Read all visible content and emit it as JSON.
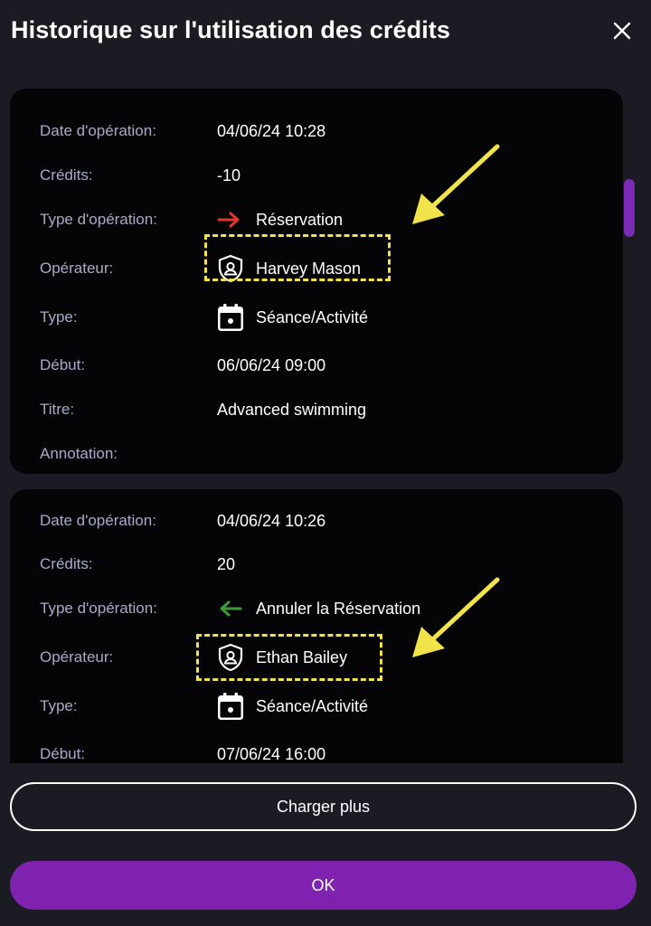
{
  "dialog": {
    "title": "Historique sur l'utilisation des crédits",
    "close_icon": "close-icon"
  },
  "entries": [
    {
      "rows": [
        {
          "label": "Date d'opération:",
          "value": "04/06/24 10:28"
        },
        {
          "label": "Crédits:",
          "value": "-10"
        },
        {
          "label": "Type d'opération:",
          "value": "Réservation",
          "icon": "arrow-right-icon",
          "icon_color": "#e8372c"
        },
        {
          "label": "Opérateur:",
          "value": "Harvey Mason",
          "icon": "shield-user-icon"
        },
        {
          "label": "Type:",
          "value": "Séance/Activité",
          "icon": "calendar-icon"
        },
        {
          "label": "Début:",
          "value": "06/06/24 09:00"
        },
        {
          "label": "Titre:",
          "value": "Advanced swimming"
        },
        {
          "label": "Annotation:",
          "value": ""
        }
      ]
    },
    {
      "rows": [
        {
          "label": "Date d'opération:",
          "value": "04/06/24 10:26"
        },
        {
          "label": "Crédits:",
          "value": "20"
        },
        {
          "label": "Type d'opération:",
          "value": "Annuler la Réservation",
          "icon": "arrow-left-icon",
          "icon_color": "#3f9a3a"
        },
        {
          "label": "Opérateur:",
          "value": "Ethan Bailey",
          "icon": "shield-user-icon"
        },
        {
          "label": "Type:",
          "value": "Séance/Activité",
          "icon": "calendar-icon"
        },
        {
          "label": "Début:",
          "value": "07/06/24 16:00"
        }
      ]
    }
  ],
  "annotation_color": "#f2e34a",
  "accent_color": "#7f22b0",
  "footer": {
    "load_more_label": "Charger plus",
    "ok_label": "OK"
  }
}
